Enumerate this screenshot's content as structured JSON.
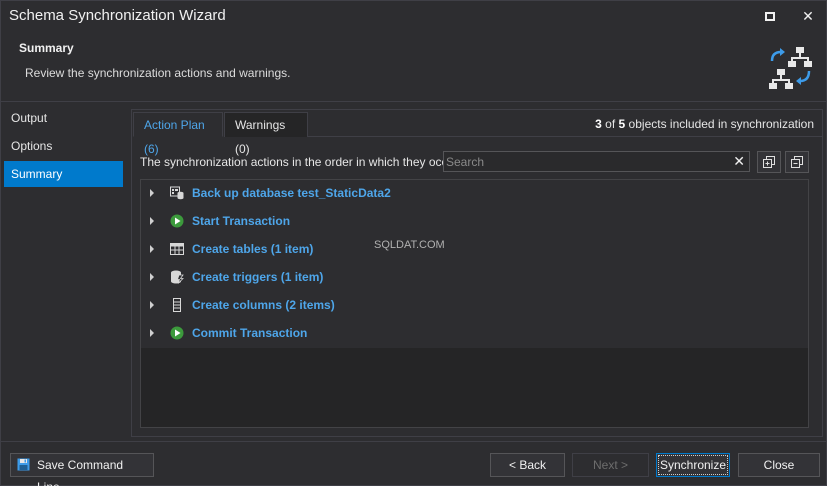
{
  "window": {
    "title": "Schema Synchronization Wizard"
  },
  "header": {
    "title": "Summary",
    "subtitle": "Review the synchronization actions and warnings."
  },
  "sidebar": {
    "items": [
      {
        "label": "Output"
      },
      {
        "label": "Options"
      },
      {
        "label": "Summary"
      }
    ]
  },
  "tabs": {
    "action_plan": "Action Plan (6)",
    "warnings": "Warnings (0)"
  },
  "counter": {
    "included": "3",
    "of_text": " of ",
    "total": "5",
    "suffix": " objects included in synchronization"
  },
  "description": "The synchronization actions in the order in which they occur.",
  "search": {
    "placeholder": "Search",
    "value": ""
  },
  "actions": [
    {
      "label": "Back up database test_StaticData2",
      "icon": "backup-database-icon"
    },
    {
      "label": "Start Transaction",
      "icon": "play-icon"
    },
    {
      "label": "Create tables (1 item)",
      "icon": "table-icon"
    },
    {
      "label": "Create triggers (1 item)",
      "icon": "trigger-icon"
    },
    {
      "label": "Create columns (2 items)",
      "icon": "column-icon"
    },
    {
      "label": "Commit Transaction",
      "icon": "play-icon"
    }
  ],
  "watermark": "SQLDAT.COM",
  "footer": {
    "save_command_line": "Save Command Line...",
    "back": "< Back",
    "next": "Next >",
    "synchronize": "Synchronize",
    "close": "Close"
  },
  "colors": {
    "accent": "#007acc",
    "link": "#4ea6ea",
    "background": "#2d2d30",
    "play": "#3c9a3c"
  }
}
